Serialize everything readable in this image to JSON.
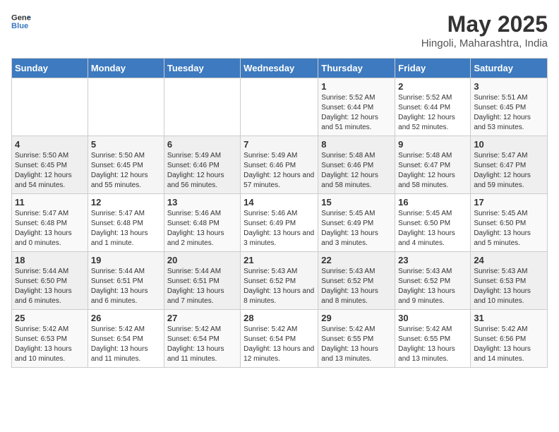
{
  "header": {
    "logo_line1": "General",
    "logo_line2": "Blue",
    "month_year": "May 2025",
    "location": "Hingoli, Maharashtra, India"
  },
  "weekdays": [
    "Sunday",
    "Monday",
    "Tuesday",
    "Wednesday",
    "Thursday",
    "Friday",
    "Saturday"
  ],
  "weeks": [
    [
      {
        "day": "",
        "sunrise": "",
        "sunset": "",
        "daylight": ""
      },
      {
        "day": "",
        "sunrise": "",
        "sunset": "",
        "daylight": ""
      },
      {
        "day": "",
        "sunrise": "",
        "sunset": "",
        "daylight": ""
      },
      {
        "day": "",
        "sunrise": "",
        "sunset": "",
        "daylight": ""
      },
      {
        "day": "1",
        "sunrise": "5:52 AM",
        "sunset": "6:44 PM",
        "daylight": "12 hours and 51 minutes."
      },
      {
        "day": "2",
        "sunrise": "5:52 AM",
        "sunset": "6:44 PM",
        "daylight": "12 hours and 52 minutes."
      },
      {
        "day": "3",
        "sunrise": "5:51 AM",
        "sunset": "6:45 PM",
        "daylight": "12 hours and 53 minutes."
      }
    ],
    [
      {
        "day": "4",
        "sunrise": "5:50 AM",
        "sunset": "6:45 PM",
        "daylight": "12 hours and 54 minutes."
      },
      {
        "day": "5",
        "sunrise": "5:50 AM",
        "sunset": "6:45 PM",
        "daylight": "12 hours and 55 minutes."
      },
      {
        "day": "6",
        "sunrise": "5:49 AM",
        "sunset": "6:46 PM",
        "daylight": "12 hours and 56 minutes."
      },
      {
        "day": "7",
        "sunrise": "5:49 AM",
        "sunset": "6:46 PM",
        "daylight": "12 hours and 57 minutes."
      },
      {
        "day": "8",
        "sunrise": "5:48 AM",
        "sunset": "6:46 PM",
        "daylight": "12 hours and 58 minutes."
      },
      {
        "day": "9",
        "sunrise": "5:48 AM",
        "sunset": "6:47 PM",
        "daylight": "12 hours and 58 minutes."
      },
      {
        "day": "10",
        "sunrise": "5:47 AM",
        "sunset": "6:47 PM",
        "daylight": "12 hours and 59 minutes."
      }
    ],
    [
      {
        "day": "11",
        "sunrise": "5:47 AM",
        "sunset": "6:48 PM",
        "daylight": "13 hours and 0 minutes."
      },
      {
        "day": "12",
        "sunrise": "5:47 AM",
        "sunset": "6:48 PM",
        "daylight": "13 hours and 1 minute."
      },
      {
        "day": "13",
        "sunrise": "5:46 AM",
        "sunset": "6:48 PM",
        "daylight": "13 hours and 2 minutes."
      },
      {
        "day": "14",
        "sunrise": "5:46 AM",
        "sunset": "6:49 PM",
        "daylight": "13 hours and 3 minutes."
      },
      {
        "day": "15",
        "sunrise": "5:45 AM",
        "sunset": "6:49 PM",
        "daylight": "13 hours and 3 minutes."
      },
      {
        "day": "16",
        "sunrise": "5:45 AM",
        "sunset": "6:50 PM",
        "daylight": "13 hours and 4 minutes."
      },
      {
        "day": "17",
        "sunrise": "5:45 AM",
        "sunset": "6:50 PM",
        "daylight": "13 hours and 5 minutes."
      }
    ],
    [
      {
        "day": "18",
        "sunrise": "5:44 AM",
        "sunset": "6:50 PM",
        "daylight": "13 hours and 6 minutes."
      },
      {
        "day": "19",
        "sunrise": "5:44 AM",
        "sunset": "6:51 PM",
        "daylight": "13 hours and 6 minutes."
      },
      {
        "day": "20",
        "sunrise": "5:44 AM",
        "sunset": "6:51 PM",
        "daylight": "13 hours and 7 minutes."
      },
      {
        "day": "21",
        "sunrise": "5:43 AM",
        "sunset": "6:52 PM",
        "daylight": "13 hours and 8 minutes."
      },
      {
        "day": "22",
        "sunrise": "5:43 AM",
        "sunset": "6:52 PM",
        "daylight": "13 hours and 8 minutes."
      },
      {
        "day": "23",
        "sunrise": "5:43 AM",
        "sunset": "6:52 PM",
        "daylight": "13 hours and 9 minutes."
      },
      {
        "day": "24",
        "sunrise": "5:43 AM",
        "sunset": "6:53 PM",
        "daylight": "13 hours and 10 minutes."
      }
    ],
    [
      {
        "day": "25",
        "sunrise": "5:42 AM",
        "sunset": "6:53 PM",
        "daylight": "13 hours and 10 minutes."
      },
      {
        "day": "26",
        "sunrise": "5:42 AM",
        "sunset": "6:54 PM",
        "daylight": "13 hours and 11 minutes."
      },
      {
        "day": "27",
        "sunrise": "5:42 AM",
        "sunset": "6:54 PM",
        "daylight": "13 hours and 11 minutes."
      },
      {
        "day": "28",
        "sunrise": "5:42 AM",
        "sunset": "6:54 PM",
        "daylight": "13 hours and 12 minutes."
      },
      {
        "day": "29",
        "sunrise": "5:42 AM",
        "sunset": "6:55 PM",
        "daylight": "13 hours and 13 minutes."
      },
      {
        "day": "30",
        "sunrise": "5:42 AM",
        "sunset": "6:55 PM",
        "daylight": "13 hours and 13 minutes."
      },
      {
        "day": "31",
        "sunrise": "5:42 AM",
        "sunset": "6:56 PM",
        "daylight": "13 hours and 14 minutes."
      }
    ]
  ],
  "labels": {
    "sunrise_prefix": "Sunrise: ",
    "sunset_prefix": "Sunset: ",
    "daylight_prefix": "Daylight: "
  }
}
